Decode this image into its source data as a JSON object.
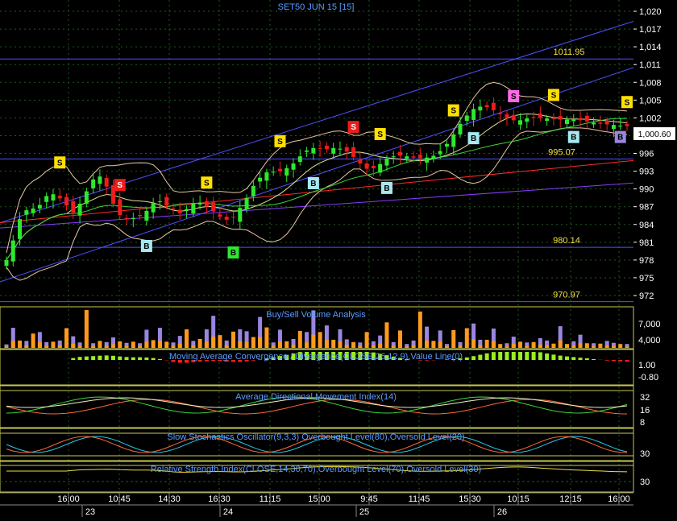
{
  "title": "SET50 JUN 15   [15]",
  "colors": {
    "background": "#000000",
    "grid": "#1e5a1e",
    "axis_text": "#ffffff",
    "title_text": "#5a9cff",
    "bull": "#2ee82e",
    "bear": "#ee1c1c",
    "label_yellow": "#f0e040",
    "channel": "#5050ff",
    "panel_border": "#c8c850",
    "vol_buy": "#ff9a1e",
    "vol_sell": "#9a86e0",
    "macd_pos": "#9aef1e",
    "macd_neg": "#ff1c1c"
  },
  "price_panel": {
    "y_ticks": [
      "1,020",
      "1,017",
      "1,014",
      "1,011",
      "1,008",
      "1,005",
      "1,002",
      "999",
      "996",
      "993",
      "990",
      "987",
      "984",
      "981",
      "978",
      "975",
      "972"
    ],
    "last_price": "1,000.60",
    "levels": [
      {
        "label": "1011.95",
        "value": 1011.95
      },
      {
        "label": "995.07",
        "value": 995.07
      },
      {
        "label": "980.14",
        "value": 980.14
      },
      {
        "label": "970.97",
        "value": 970.97
      }
    ]
  },
  "indicators": [
    {
      "name": "Buy/Sell Volume Analysis",
      "y_ticks": [
        "7,000",
        "4,000"
      ]
    },
    {
      "name": "Moving Average Convergence / Divergence(CLOSE,26,12,9),Value Line(0)",
      "y_ticks": [
        "1.00",
        "-0.80"
      ]
    },
    {
      "name": "Average Directional Movement Index(14)",
      "y_ticks": [
        "32",
        "16",
        "8"
      ]
    },
    {
      "name": "Slow Stochastics Oscillator(9,3,3) Overbought Level(80),Oversold Level(20)",
      "y_ticks": [
        "30"
      ]
    },
    {
      "name": "Relative Strength Index(CLOSE,14,30,70),Overbought Level(70),Oversold Level(30)",
      "y_ticks": [
        "30"
      ]
    }
  ],
  "x_axis": {
    "times": [
      "16:00",
      "10:45",
      "14:30",
      "16:30",
      "11:15",
      "15:00",
      "9:45",
      "11:45",
      "15:30",
      "10:15",
      "12:15",
      "16:00"
    ],
    "dates": [
      "23",
      "24",
      "25",
      "26"
    ]
  },
  "signals": {
    "sell_label": "S",
    "buy_label": "B"
  },
  "chart_data": [
    {
      "type": "line",
      "title": "SET50 JUN 15   [15]",
      "series": [
        {
          "name": "Close",
          "values": [
            978.0,
            981.3,
            984.9,
            986.4,
            986.7,
            987.3,
            988.8,
            989.1,
            988.4,
            987.2,
            986.0,
            987.5,
            989.6,
            991.6,
            992.1,
            990.4,
            987.5,
            985.6,
            984.9,
            985.1,
            985.4,
            986.3,
            987.6,
            987.9,
            987.2,
            986.5,
            985.9,
            986.6,
            987.6,
            987.7,
            987.0,
            986.2,
            985.3,
            984.8,
            985.2,
            986.8,
            988.5,
            990.5,
            991.9,
            992.8,
            992.9,
            993.0,
            993.5,
            994.3,
            995.5,
            996.5,
            996.9,
            996.8,
            996.7,
            996.9,
            996.8,
            996.3,
            995.4,
            994.3,
            993.4,
            993.5,
            994.2,
            995.1,
            995.5,
            995.6,
            995.5,
            995.3,
            995.2,
            995.3,
            995.6,
            996.4,
            997.6,
            999.2,
            1001.0,
            1002.4,
            1003.5,
            1003.9,
            1003.8,
            1003.3,
            1002.6,
            1002.0,
            1001.6,
            1001.6,
            1001.9,
            1002.0,
            1002.0,
            1001.9,
            1001.8,
            1001.7,
            1001.7,
            1001.7,
            1001.6,
            1001.4,
            1001.2,
            1001.0,
            1000.9,
            1000.8,
            1000.7,
            1000.6
          ]
        }
      ],
      "ylim": [
        970,
        1021
      ]
    },
    {
      "type": "bar",
      "title": "Buy/Sell Volume Analysis",
      "series": [
        {
          "values": [
            900,
            5200,
            1900,
            1800,
            3700,
            4100,
            1500,
            1600,
            1900,
            5100,
            3000,
            1400,
            9800,
            1200,
            1800,
            1500,
            2700,
            1700,
            1300,
            1600,
            1200,
            4700,
            2000,
            5200,
            1600,
            1400,
            3100,
            4800,
            1800,
            2300,
            4800,
            8300,
            3300,
            1900,
            4200,
            4800,
            4300,
            2800,
            8000,
            5300,
            1400,
            4700,
            1700,
            2300,
            4400,
            4100,
            9700,
            4100,
            5800,
            2100,
            4800,
            2200,
            1500,
            1400,
            4100,
            1700,
            3200,
            6600,
            1500,
            4500,
            1000,
            1900,
            9400,
            5500,
            1800,
            4500,
            1000,
            4600,
            1500,
            5100,
            6300,
            2100,
            2100,
            5000,
            1000,
            1200,
            2900,
            1600,
            1400,
            1500,
            2500,
            1900,
            1100,
            5600,
            1000,
            1700,
            3400,
            1200,
            1200,
            1100,
            1800,
            1300,
            1000,
            1000
          ]
        }
      ]
    }
  ]
}
